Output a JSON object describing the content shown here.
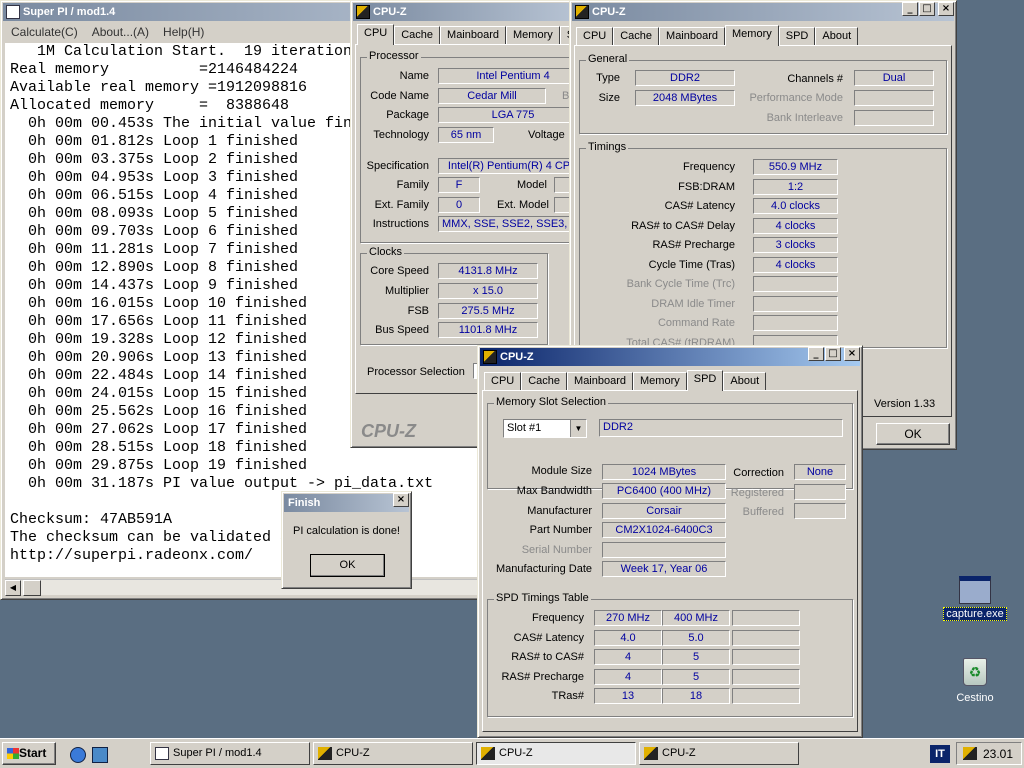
{
  "superpi": {
    "title": "Super PI / mod1.4",
    "menu": [
      "Calculate(C)",
      "About...(A)",
      "Help(H)"
    ],
    "lines": [
      "   1M Calculation Start.  19 iterations.",
      "Real memory          =2146484224",
      "Available real memory =1912098816",
      "Allocated memory     =  8388648",
      "  0h 00m 00.453s The initial value finished",
      "  0h 00m 01.812s Loop 1 finished",
      "  0h 00m 03.375s Loop 2 finished",
      "  0h 00m 04.953s Loop 3 finished",
      "  0h 00m 06.515s Loop 4 finished",
      "  0h 00m 08.093s Loop 5 finished",
      "  0h 00m 09.703s Loop 6 finished",
      "  0h 00m 11.281s Loop 7 finished",
      "  0h 00m 12.890s Loop 8 finished",
      "  0h 00m 14.437s Loop 9 finished",
      "  0h 00m 16.015s Loop 10 finished",
      "  0h 00m 17.656s Loop 11 finished",
      "  0h 00m 19.328s Loop 12 finished",
      "  0h 00m 20.906s Loop 13 finished",
      "  0h 00m 22.484s Loop 14 finished",
      "  0h 00m 24.015s Loop 15 finished",
      "  0h 00m 25.562s Loop 16 finished",
      "  0h 00m 27.062s Loop 17 finished",
      "  0h 00m 28.515s Loop 18 finished",
      "  0h 00m 29.875s Loop 19 finished",
      "  0h 00m 31.187s PI value output -> pi_data.txt",
      "",
      "Checksum: 47AB591A",
      "The checksum can be validated at",
      "http://superpi.radeonx.com/"
    ]
  },
  "finish_dialog": {
    "title": "Finish",
    "message": "PI calculation is done!",
    "ok": "OK"
  },
  "cpuz_cpu": {
    "title": "CPU-Z",
    "tabs": [
      "CPU",
      "Cache",
      "Mainboard",
      "Memory",
      "SPD"
    ],
    "processor_label": "Processor",
    "name_label": "Name",
    "name": "Intel Pentium 4",
    "codename_label": "Code Name",
    "codename": "Cedar Mill",
    "brand_label": "Brand ID",
    "package_label": "Package",
    "package": "LGA 775",
    "tech_label": "Technology",
    "tech": "65 nm",
    "voltage_label": "Voltage",
    "spec_label": "Specification",
    "spec": "Intel(R) Pentium(R) 4 CPU",
    "family_label": "Family",
    "family": "F",
    "model_label": "Model",
    "extfamily_label": "Ext. Family",
    "extfamily": "0",
    "extmodel_label": "Ext. Model",
    "instr_label": "Instructions",
    "instr": "MMX, SSE, SSE2, SSE3, EM64T",
    "clocks_label": "Clocks",
    "corespeed_label": "Core Speed",
    "corespeed": "4131.8 MHz",
    "multiplier_label": "Multiplier",
    "multiplier": "x 15.0",
    "fsb_label": "FSB",
    "fsb": "275.5 MHz",
    "busspeed_label": "Bus Speed",
    "busspeed": "1101.8 MHz",
    "procsel_label": "Processor Selection",
    "brand": "CPU-Z"
  },
  "cpuz_mem": {
    "title": "CPU-Z",
    "tabs": [
      "CPU",
      "Cache",
      "Mainboard",
      "Memory",
      "SPD",
      "About"
    ],
    "general_label": "General",
    "type_label": "Type",
    "type": "DDR2",
    "size_label": "Size",
    "size": "2048 MBytes",
    "channels_label": "Channels #",
    "channels": "Dual",
    "perfmode_label": "Performance Mode",
    "bankinter_label": "Bank Interleave",
    "timings_label": "Timings",
    "timings": [
      {
        "label": "Frequency",
        "value": "550.9 MHz",
        "disabled": false
      },
      {
        "label": "FSB:DRAM",
        "value": "1:2",
        "disabled": false
      },
      {
        "label": "CAS# Latency",
        "value": "4.0 clocks",
        "disabled": false
      },
      {
        "label": "RAS# to CAS# Delay",
        "value": "4 clocks",
        "disabled": false
      },
      {
        "label": "RAS# Precharge",
        "value": "3 clocks",
        "disabled": false
      },
      {
        "label": "Cycle Time (Tras)",
        "value": "4 clocks",
        "disabled": false
      },
      {
        "label": "Bank Cycle Time (Trc)",
        "value": "",
        "disabled": true
      },
      {
        "label": "DRAM Idle Timer",
        "value": "",
        "disabled": true
      },
      {
        "label": "Command Rate",
        "value": "",
        "disabled": true
      },
      {
        "label": "Total CAS# (tRDRAM)",
        "value": "",
        "disabled": true
      }
    ],
    "version": "Version 1.33",
    "ok": "OK"
  },
  "cpuz_spd": {
    "title": "CPU-Z",
    "tabs": [
      "CPU",
      "Cache",
      "Mainboard",
      "Memory",
      "SPD",
      "About"
    ],
    "slotsel_label": "Memory Slot Selection",
    "slot": "Slot #1",
    "slot_type": "DDR2",
    "modsize_label": "Module Size",
    "modsize": "1024 MBytes",
    "correction_label": "Correction",
    "correction": "None",
    "maxbw_label": "Max Bandwidth",
    "maxbw": "PC6400 (400 MHz)",
    "registered_label": "Registered",
    "manufacturer_label": "Manufacturer",
    "manufacturer": "Corsair",
    "buffered_label": "Buffered",
    "partnum_label": "Part Number",
    "partnum": "CM2X1024-6400C3",
    "serial_label": "Serial Number",
    "mfgdate_label": "Manufacturing Date",
    "mfgdate": "Week 17, Year 06",
    "table_label": "SPD Timings Table",
    "table": [
      {
        "label": "Frequency",
        "c1": "270 MHz",
        "c2": "400 MHz"
      },
      {
        "label": "CAS# Latency",
        "c1": "4.0",
        "c2": "5.0"
      },
      {
        "label": "RAS# to CAS#",
        "c1": "4",
        "c2": "5"
      },
      {
        "label": "RAS# Precharge",
        "c1": "4",
        "c2": "5"
      },
      {
        "label": "TRas#",
        "c1": "13",
        "c2": "18"
      }
    ]
  },
  "desktop": {
    "capture": "capture.exe",
    "trash": "Cestino"
  },
  "taskbar": {
    "start": "Start",
    "items": [
      "Super PI / mod1.4",
      "CPU-Z",
      "CPU-Z",
      "CPU-Z"
    ],
    "lang": "IT",
    "clock": "23.01"
  }
}
